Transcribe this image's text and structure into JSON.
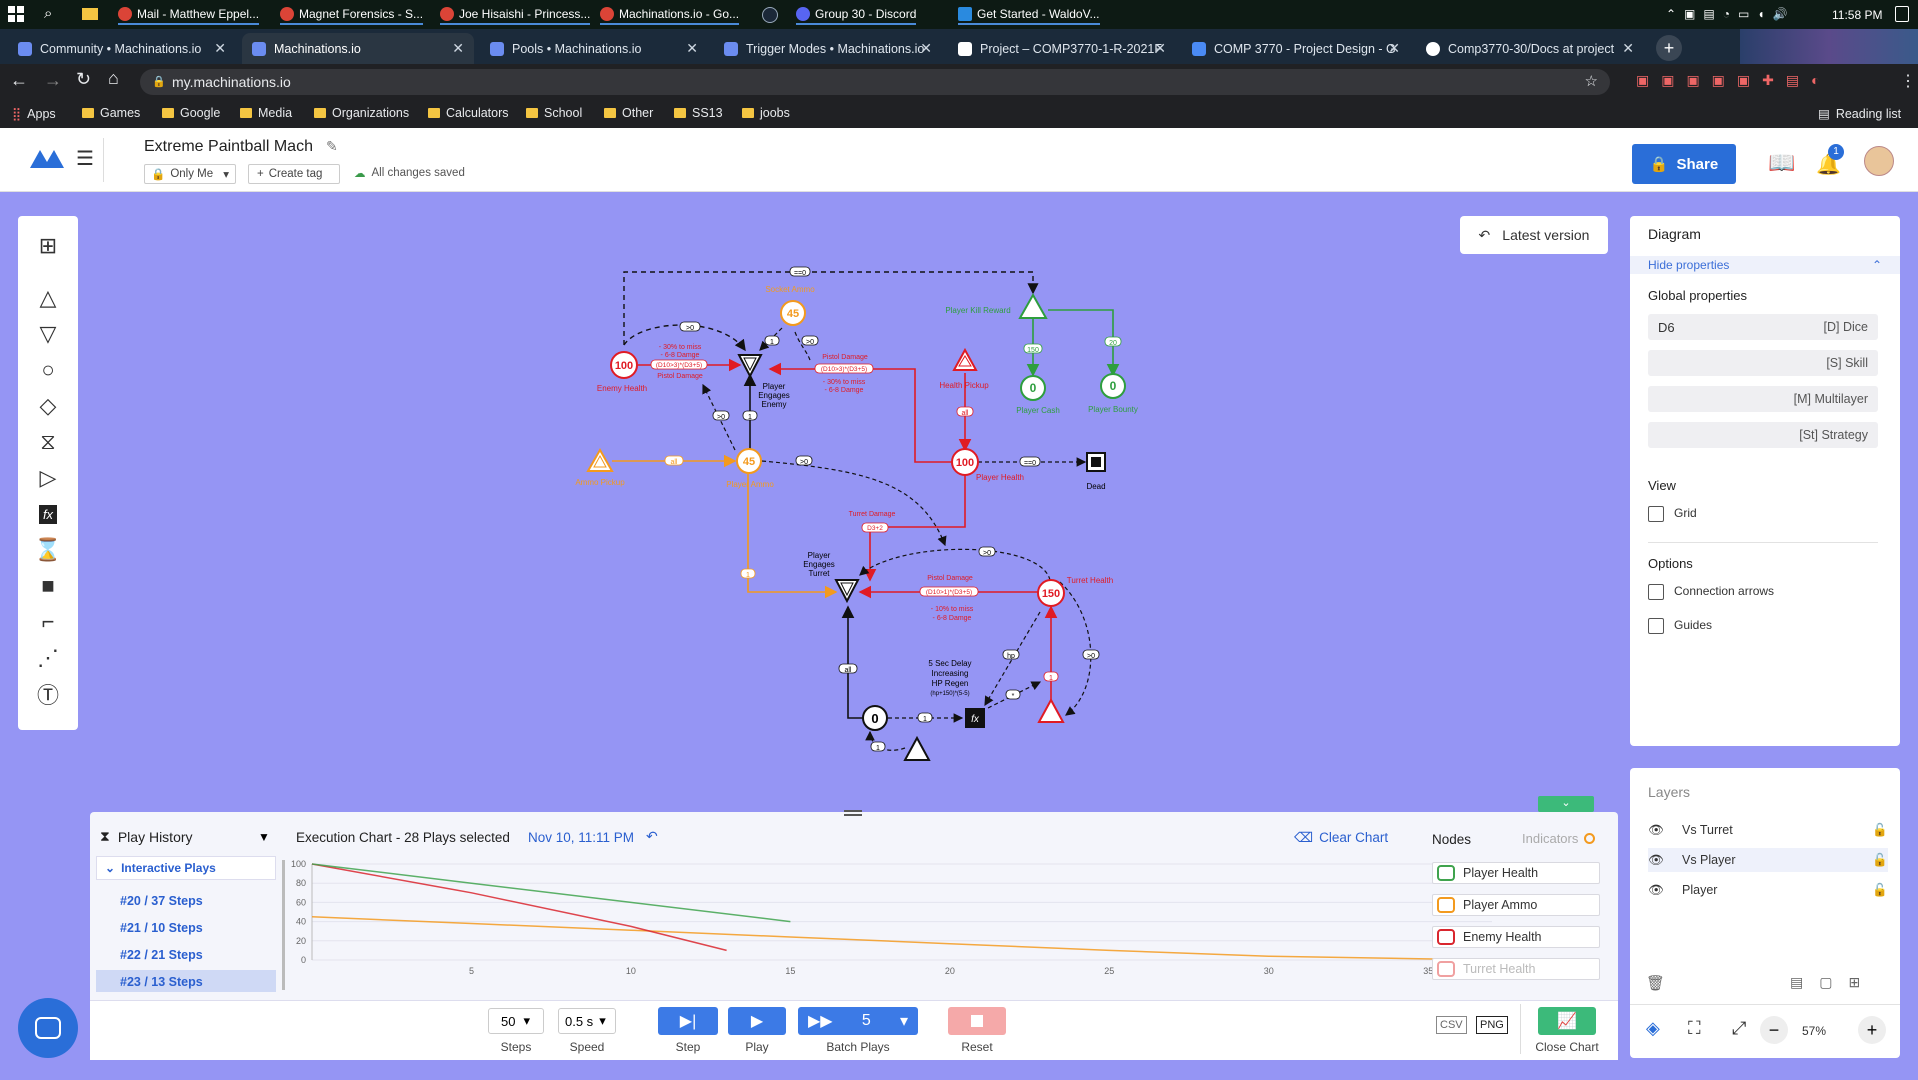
{
  "taskbar": {
    "items": [
      "Mail - Matthew Eppel...",
      "Magnet Forensics - S...",
      "Joe Hisaishi - Princess...",
      "Machinations.io - Go...",
      "Group 30 - Discord",
      "Get Started - WaldoV..."
    ],
    "time": "11:58 PM"
  },
  "browser": {
    "tabs": [
      "Community • Machinations.io",
      "Machinations.io",
      "Pools • Machinations.io",
      "Trigger Modes • Machinations.io",
      "Project – COMP3770-1-R-2021F",
      "COMP 3770 - Project Design - G",
      "Comp3770-30/Docs at project"
    ],
    "url": "my.machinations.io",
    "bookmarks": [
      "Apps",
      "Games",
      "Google",
      "Media",
      "Organizations",
      "Calculators",
      "School",
      "Other",
      "SS13",
      "joobs"
    ],
    "reading_list": "Reading list"
  },
  "header": {
    "title": "Extreme Paintball Mach",
    "visibility": "Only Me",
    "create_tag": "Create tag",
    "save_status": "All changes saved",
    "share": "Share",
    "notif_count": "1"
  },
  "canvas": {
    "latest_version": "Latest version"
  },
  "diagram": {
    "nodes": {
      "enemy_health": {
        "value": "100",
        "label": "Enemy Health"
      },
      "socket_ammo": {
        "value": "45",
        "label": "Socket Ammo"
      },
      "player_kill_reward": {
        "label": "Player Kill Reward"
      },
      "player_cash": {
        "value": "0",
        "label": "Player Cash"
      },
      "player_bounty": {
        "value": "0",
        "label": "Player Bounty"
      },
      "health_pickup": {
        "label": "Health Pickup"
      },
      "player_health": {
        "value": "100",
        "label": "Player Health"
      },
      "dead": {
        "label": "Dead"
      },
      "player_engages_enemy": {
        "label1": "Player",
        "label2": "Engages",
        "label3": "Enemy"
      },
      "ammo_pickup": {
        "label": "Ammo Pickup"
      },
      "player_ammo": {
        "value": "45",
        "label": "Player Ammo"
      },
      "player_engages_turret": {
        "label1": "Player",
        "label2": "Engages",
        "label3": "Turret"
      },
      "turret_health": {
        "value": "150",
        "label": "Turret Health"
      },
      "regen_note": {
        "l1": "5 Sec Delay",
        "l2": "Increasing",
        "l3": "HP Regen",
        "l4": "(hp+150)*(5-5)"
      },
      "counter": {
        "value": "0"
      },
      "fx": "fx"
    },
    "edge_labels": {
      "top_loop": "==0",
      "pd1_a": "- 30% to miss",
      "pd1_b": "- 6-8 Damge",
      "pd1_c": "(D10>3)*(D3+5)",
      "pd1_d": "Pistol Damage",
      "pd2_a": "Pistol Damage",
      "pd2_b": "(D10>3)*(D3+5)",
      "pd2_c": "- 30% to miss",
      "pd2_d": "- 6-8 Damge",
      "kill_150": "150",
      "kill_20": "20",
      "gt0": ">0",
      "one": "1",
      "all": "all",
      "eq0": "==0",
      "turret_damage": "Turret Damage",
      "turret_dmg_val": "D3+2",
      "pd3_a": "Pistol Damage",
      "pd3_b": "(D10>1)*(D3+5)",
      "pd3_c": "- 10% to miss",
      "pd3_d": "- 6-8 Damge",
      "hp": "hp",
      "star": "*"
    }
  },
  "right_panel": {
    "title": "Diagram",
    "hide_props": "Hide properties",
    "global_props": "Global properties",
    "props": [
      {
        "value": "D6",
        "key": "[D] Dice"
      },
      {
        "value": "",
        "key": "[S] Skill"
      },
      {
        "value": "",
        "key": "[M] Multilayer"
      },
      {
        "value": "",
        "key": "[St] Strategy"
      }
    ],
    "view": "View",
    "grid": "Grid",
    "options": "Options",
    "connection_arrows": "Connection arrows",
    "guides": "Guides"
  },
  "layers": {
    "title": "Layers",
    "items": [
      "Vs Turret",
      "Vs Player",
      "Player"
    ],
    "zoom": "57%"
  },
  "chart_panel": {
    "play_history": "Play History",
    "interactive_plays": "Interactive Plays",
    "plays": [
      "#20 / 37 Steps",
      "#21 / 10 Steps",
      "#22 / 21 Steps",
      "#23 / 13 Steps"
    ],
    "execution_chart": "Execution Chart",
    "plays_selected": "- 28 Plays selected",
    "timestamp": "Nov 10, 11:11 PM",
    "clear_chart": "Clear Chart",
    "nodes_title": "Nodes",
    "indicators": "Indicators",
    "nodes": [
      "Player Health",
      "Player Ammo",
      "Enemy Health",
      "Turret Health"
    ],
    "node_colors": [
      "#3fa34d",
      "#f39a1e",
      "#d9262e",
      "#f0a0a0"
    ]
  },
  "controls": {
    "steps": "50",
    "steps_label": "Steps",
    "speed": "0.5 s",
    "speed_label": "Speed",
    "step": "Step",
    "play": "Play",
    "batch_count": "5",
    "batch": "Batch Plays",
    "reset": "Reset",
    "close_chart": "Close Chart"
  },
  "chart_data": {
    "type": "line",
    "ylim": [
      0,
      100
    ],
    "xlim": [
      0,
      37
    ],
    "y_ticks": [
      0,
      20,
      40,
      60,
      80,
      100
    ],
    "x_ticks": [
      5,
      10,
      15,
      20,
      25,
      30,
      35
    ],
    "series": [
      {
        "name": "Player Ammo",
        "color": "#f39a1e",
        "x": [
          0,
          5,
          10,
          15,
          20,
          25,
          30,
          37
        ],
        "y": [
          45,
          38,
          31,
          24,
          17,
          10,
          4,
          0
        ]
      },
      {
        "name": "Enemy Health",
        "color": "#d9262e",
        "x": [
          0,
          5,
          10,
          13
        ],
        "y": [
          100,
          70,
          35,
          10
        ]
      },
      {
        "name": "Player Health",
        "color": "#3fa34d",
        "x": [
          0,
          5,
          10,
          15
        ],
        "y": [
          100,
          80,
          60,
          40
        ]
      }
    ]
  }
}
